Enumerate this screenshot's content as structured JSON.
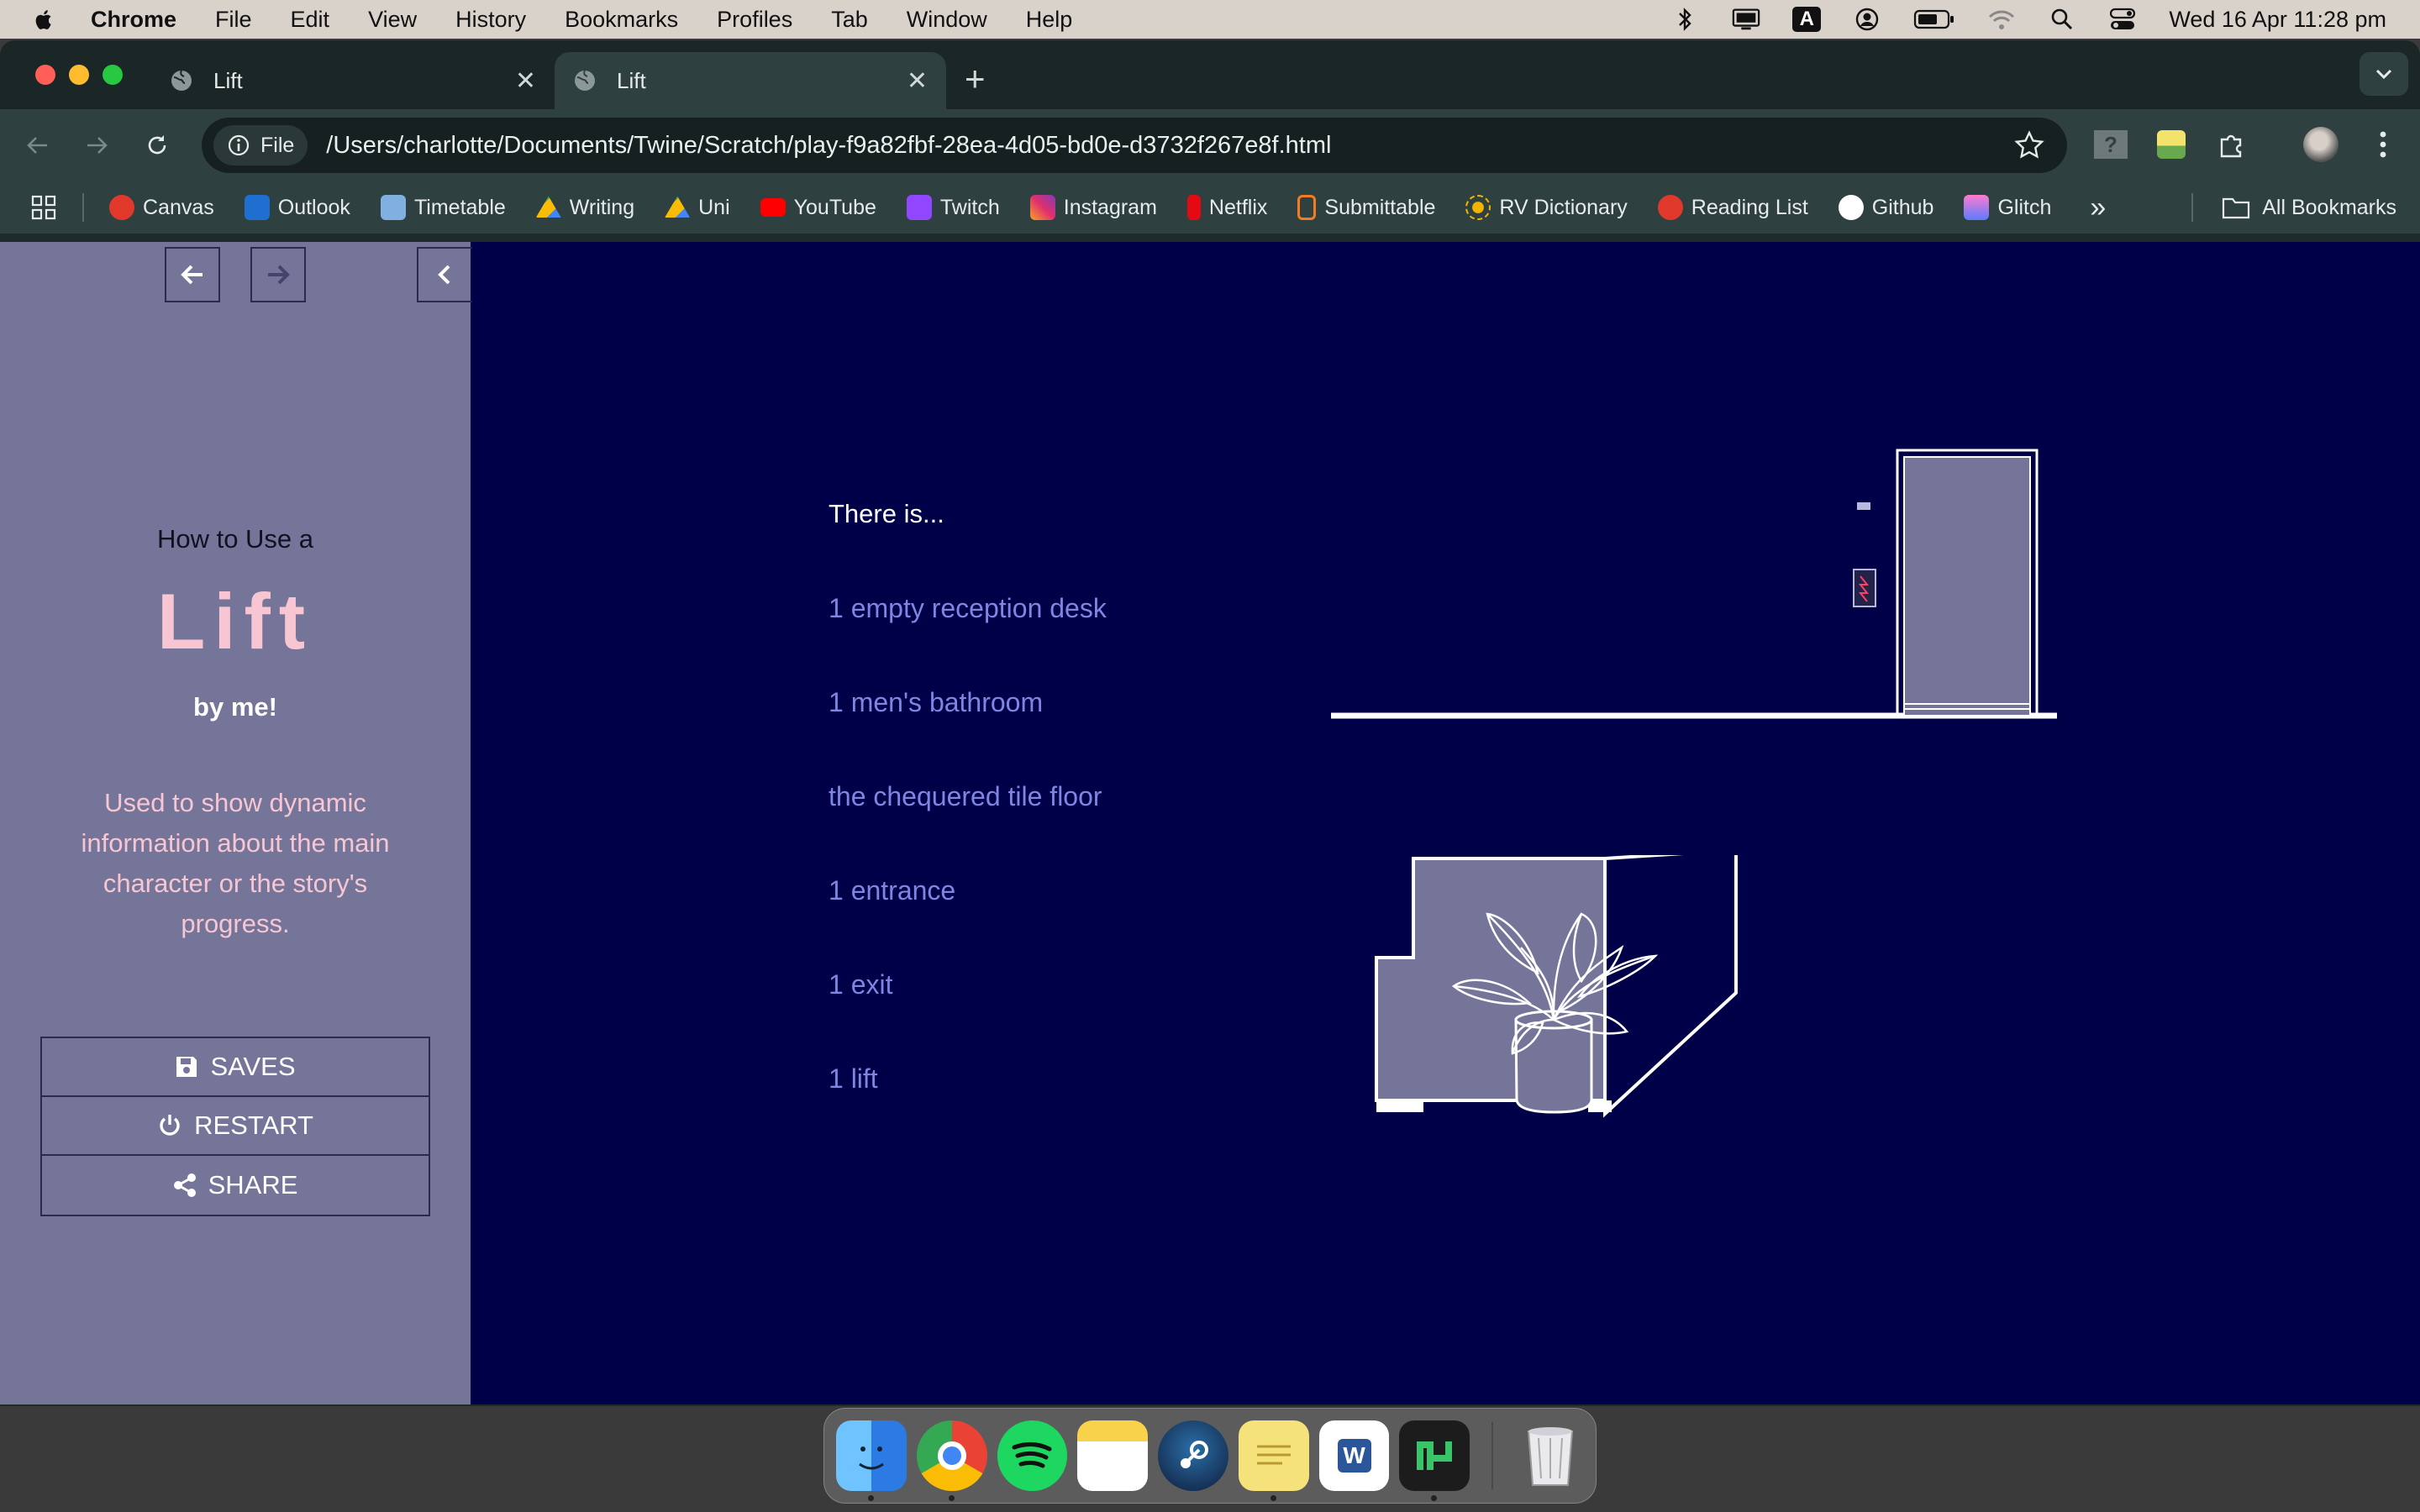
{
  "menubar": {
    "app_name": "Chrome",
    "items": [
      "File",
      "Edit",
      "View",
      "History",
      "Bookmarks",
      "Profiles",
      "Tab",
      "Window",
      "Help"
    ],
    "clock": "Wed 16 Apr  11:28 pm",
    "input_source": "A"
  },
  "browser": {
    "tabs": [
      {
        "title": "Lift",
        "active": false
      },
      {
        "title": "Lift",
        "active": true
      }
    ],
    "omnibox": {
      "chip_label": "File",
      "url": "/Users/charlotte/Documents/Twine/Scratch/play-f9a82fbf-28ea-4d05-bd0e-d3732f267e8f.html"
    },
    "bookmarks": [
      {
        "label": "Canvas",
        "color": "#e0392b"
      },
      {
        "label": "Outlook",
        "color": "#1f6fd0"
      },
      {
        "label": "Timetable",
        "color": "#7fb0e0"
      },
      {
        "label": "Writing",
        "color": "#34a853"
      },
      {
        "label": "Uni",
        "color": "#fbbc05"
      },
      {
        "label": "YouTube",
        "color": "#ff0000"
      },
      {
        "label": "Twitch",
        "color": "#9146ff"
      },
      {
        "label": "Instagram",
        "color": "#e1306c"
      },
      {
        "label": "Netflix",
        "color": "#e50914"
      },
      {
        "label": "Submittable",
        "color": "#f47b20"
      },
      {
        "label": "RV Dictionary",
        "color": "#f5b400"
      },
      {
        "label": "Reading List",
        "color": "#e0392b"
      },
      {
        "label": "Github",
        "color": "#ffffff"
      },
      {
        "label": "Glitch",
        "color": "#c765ff"
      }
    ],
    "all_bookmarks": "All Bookmarks",
    "overflow": "»"
  },
  "story": {
    "sidebar": {
      "pretitle": "How to Use a",
      "title": "Lift",
      "author": "by me!",
      "caption": "Used to show dynamic information about the main character or the story's progress.",
      "menu": {
        "saves": "SAVES",
        "restart": "RESTART",
        "share": "SHARE"
      }
    },
    "passage": {
      "heading": "There is...",
      "links": [
        "1 empty reception desk",
        "1 men's bathroom",
        "the chequered tile floor",
        "1 entrance",
        "1 exit",
        "1 lift"
      ]
    },
    "colors": {
      "background": "#000048",
      "sidebar": "#757599",
      "link": "#7e86e2",
      "title": "#f7c6d2"
    }
  },
  "dock": {
    "apps": [
      "finder-icon",
      "chrome-icon",
      "spotify-icon",
      "notes-icon",
      "steam-icon",
      "stickies-icon",
      "word-icon",
      "twine-icon"
    ],
    "trash": "trash-icon"
  }
}
